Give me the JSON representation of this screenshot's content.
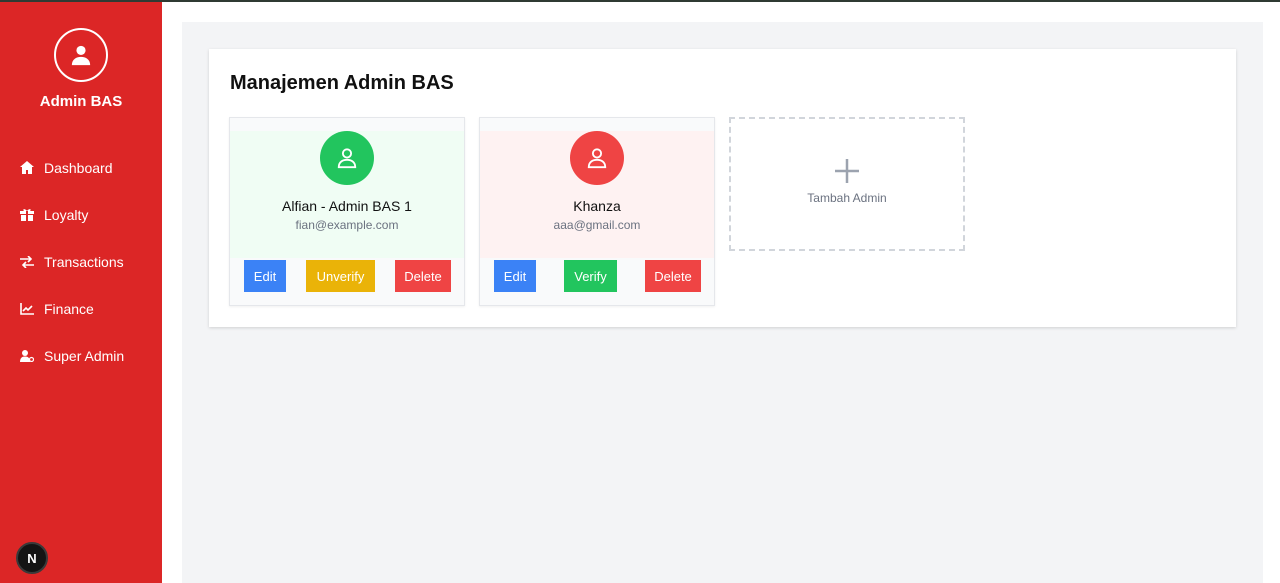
{
  "sidebar": {
    "brand": "Admin BAS",
    "items": [
      {
        "label": "Dashboard",
        "icon": "home-icon"
      },
      {
        "label": "Loyalty",
        "icon": "gift-icon"
      },
      {
        "label": "Transactions",
        "icon": "exchange-icon"
      },
      {
        "label": "Finance",
        "icon": "chart-line-icon"
      },
      {
        "label": "Super Admin",
        "icon": "user-cog-icon"
      }
    ],
    "badge": "N"
  },
  "main": {
    "title": "Manajemen Admin BAS",
    "admins": [
      {
        "name": "Alfian - Admin BAS 1",
        "email": "fian@example.com",
        "status_color": "#22c55e",
        "actions": [
          "Edit",
          "Unverify",
          "Delete"
        ]
      },
      {
        "name": "Khanza",
        "email": "aaa@gmail.com",
        "status_color": "#ef4444",
        "actions": [
          "Edit",
          "Verify",
          "Delete"
        ]
      }
    ],
    "add_label": "Tambah Admin"
  },
  "colors": {
    "sidebar": "#dc2626",
    "edit": "#3b82f6",
    "unverify": "#eab308",
    "verify": "#22c55e",
    "delete": "#ef4444"
  }
}
